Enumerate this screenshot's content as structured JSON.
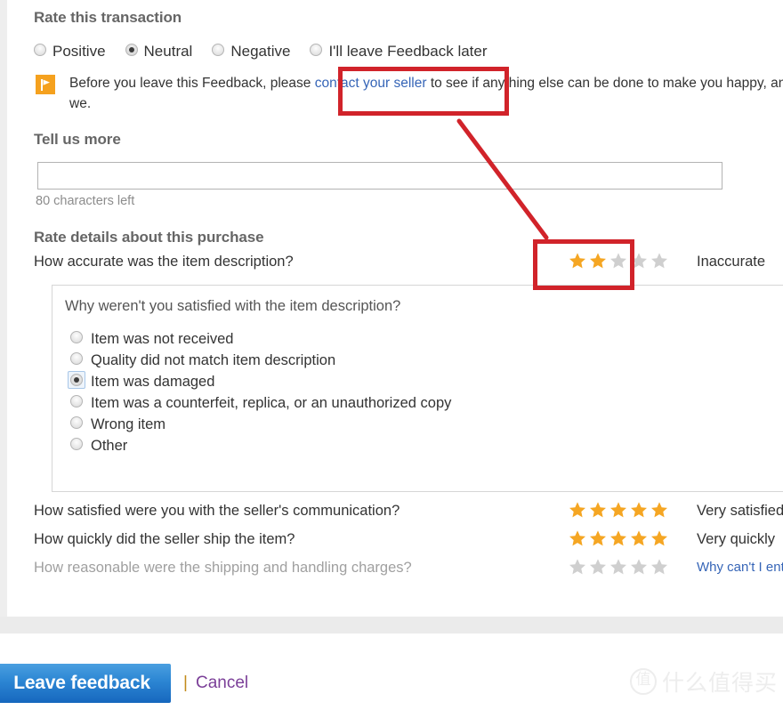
{
  "section_titles": {
    "rate_transaction": "Rate this transaction",
    "tell_us_more": "Tell us more",
    "rate_details": "Rate details about this purchase"
  },
  "transaction_rating": {
    "options": [
      {
        "label": "Positive",
        "checked": false
      },
      {
        "label": "Neutral",
        "checked": true
      },
      {
        "label": "Negative",
        "checked": false
      },
      {
        "label": "I'll leave Feedback later",
        "checked": false
      }
    ]
  },
  "notice": {
    "icon": "flag-icon",
    "text_before": "Before you leave this Feedback, please ",
    "link_text": "contact your seller",
    "text_after": " to see if anything else can be done to make you happy, and so do we."
  },
  "tell_us_more": {
    "value": "",
    "placeholder": "",
    "chars_left": "80 characters left"
  },
  "detail_ratings": [
    {
      "question": "How accurate was the item description?",
      "stars_filled": 2,
      "stars_total": 5,
      "label": "Inaccurate",
      "muted": false,
      "label_is_link": false
    },
    {
      "question": "How satisfied were you with the seller's communication?",
      "stars_filled": 5,
      "stars_total": 5,
      "label": "Very satisfied",
      "muted": false,
      "label_is_link": false
    },
    {
      "question": "How quickly did the seller ship the item?",
      "stars_filled": 5,
      "stars_total": 5,
      "label": "Very quickly",
      "muted": false,
      "label_is_link": false
    },
    {
      "question": "How reasonable were the shipping and handling charges?",
      "stars_filled": 0,
      "stars_total": 5,
      "label": "Why can't I enter a rating?",
      "muted": true,
      "label_is_link": true
    }
  ],
  "dissatisfaction_panel": {
    "title": "Why weren't you satisfied with the item description?",
    "options": [
      {
        "label": "Item was not received",
        "checked": false
      },
      {
        "label": "Quality did not match item description",
        "checked": false
      },
      {
        "label": "Item was damaged",
        "checked": true
      },
      {
        "label": "Item was a counterfeit, replica, or an unauthorized copy",
        "checked": false
      },
      {
        "label": "Wrong item",
        "checked": false
      },
      {
        "label": "Other",
        "checked": false
      }
    ]
  },
  "footer": {
    "submit_label": "Leave feedback",
    "separator": "|",
    "cancel_label": "Cancel"
  },
  "watermark": {
    "badge": "值",
    "text": "什么值得买"
  },
  "colors": {
    "star_filled": "#f5a623",
    "star_empty": "#cfcfcf",
    "link": "#3665b7",
    "annotation": "#d1232a",
    "primary_button": "#1667be",
    "flag_badge": "#f5a11e",
    "cancel_link": "#7b3f98"
  }
}
